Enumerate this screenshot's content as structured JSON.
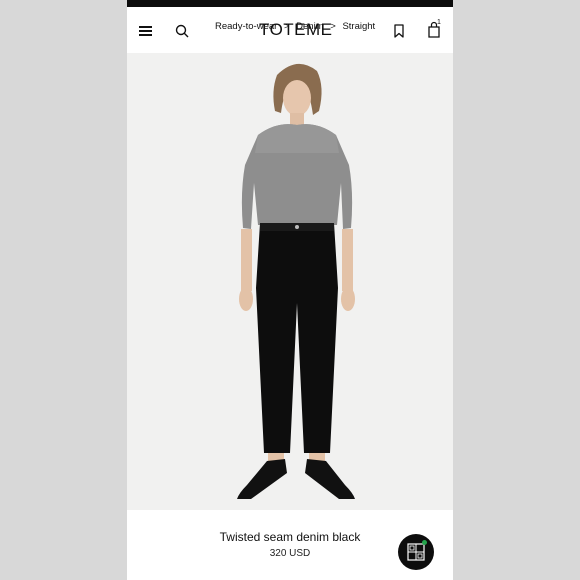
{
  "header": {
    "logo": "TOTEME",
    "breadcrumb": {
      "item1": "Ready-to-wear",
      "item2": "Denim",
      "item3": "Straight",
      "separator": ">"
    },
    "bag_count": "1"
  },
  "product": {
    "name": "Twisted seam denim black",
    "price": "320 USD"
  },
  "icons": [
    "menu-icon",
    "search-icon",
    "bookmark-icon",
    "bag-icon",
    "brand-badge-icon"
  ]
}
